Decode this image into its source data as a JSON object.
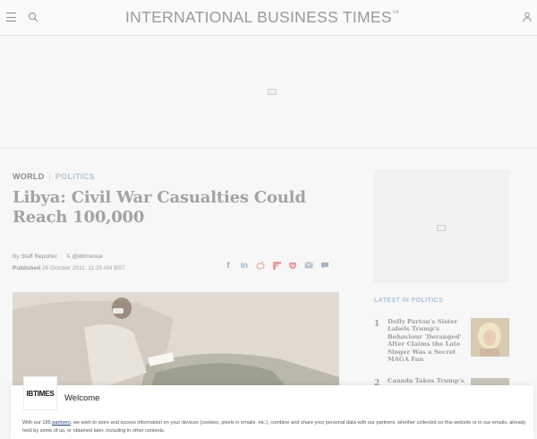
{
  "header": {
    "logo": "INTERNATIONAL BUSINESS TIMES",
    "logo_sup": "UK"
  },
  "article": {
    "tag_world": "WORLD",
    "tag_politics": "POLITICS",
    "headline": "Libya: Civil War Casualties Could Reach 100,000",
    "byline_prefix": "By",
    "author": "Staff Reporter",
    "x_handle": "@ibtimesuk",
    "published_label": "Published",
    "published_date": "26 October 2011, 11:35 AM BST"
  },
  "share": [
    "facebook-icon",
    "linkedin-icon",
    "reddit-icon",
    "flipboard-icon",
    "pocket-icon",
    "email-icon",
    "comment-icon"
  ],
  "sidebar": {
    "latest_title": "LATEST IN POLITICS",
    "items": [
      {
        "num": "1",
        "text": "Dolly Parton's Sister Labels Trump's Behaviour 'Deranged' After Claims the Late Singer Was a Secret MAGA Fan"
      },
      {
        "num": "2",
        "text": "Canada Takes Trump's"
      }
    ]
  },
  "consent": {
    "logo": "IBTIMES",
    "title": "Welcome",
    "text_before": "With our 185 ",
    "link": "partners",
    "text_after": ", we wish to store and access information on your devices (cookies, pixels in emails, etc.), combine and share your personal data with our partners, whether collected on this website or in our emails, already held by some of us, or obtained later, including in other contexts."
  },
  "colors": {
    "accent_blue": "#a9c2db",
    "headline": "#a3a3a3",
    "overlay": "#f7f7f7"
  }
}
